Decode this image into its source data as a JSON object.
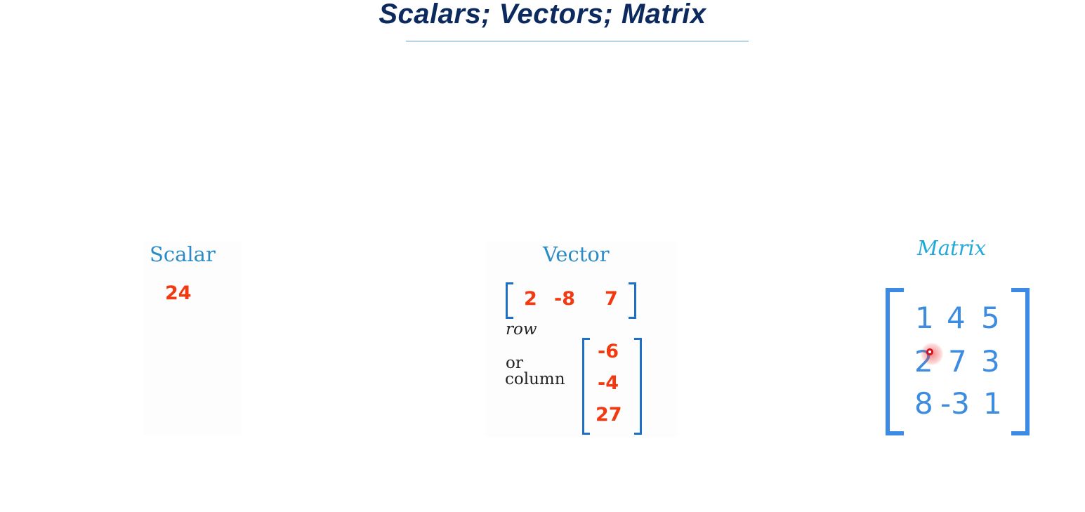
{
  "title": "Scalars;  Vectors;  Matrix",
  "scalar": {
    "heading": "Scalar",
    "value": "24"
  },
  "vector": {
    "heading": "Vector",
    "row_values": [
      "2",
      "-8",
      "7"
    ],
    "row_label": "row",
    "or_label": "or",
    "column_label": "column",
    "column_values": [
      "-6",
      "-4",
      "27"
    ]
  },
  "matrix": {
    "heading": "Matrix",
    "rows": [
      [
        "1",
        "4",
        "5"
      ],
      [
        "2",
        "7",
        "3"
      ],
      [
        "8",
        "-3",
        "1"
      ]
    ]
  },
  "colors": {
    "title": "#0d2a5e",
    "heading": "#2b8bc6",
    "value_red": "#f23a12",
    "matrix_blue": "#3d8ce0"
  }
}
